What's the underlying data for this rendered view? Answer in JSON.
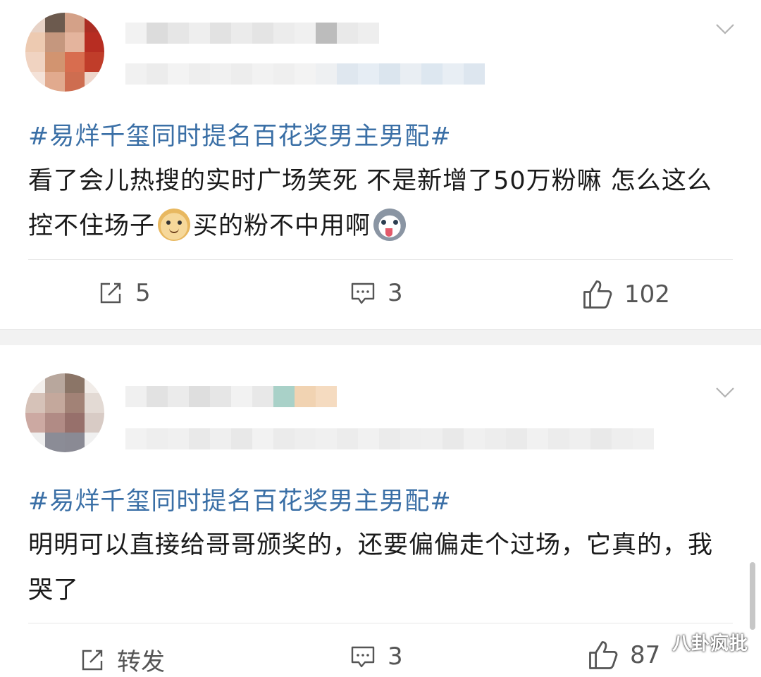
{
  "posts": [
    {
      "topic": "#易烊千玺同时提名百花奖男主男配#",
      "text_part1": "看了会儿热搜的实时广场笑死 不是新增了50万粉嘛 怎么这么控不住场子",
      "text_part2": "买的粉不中用啊",
      "actions": {
        "repost": "5",
        "comment": "3",
        "like": "102"
      }
    },
    {
      "topic": "#易烊千玺同时提名百花奖男主男配#",
      "text": "明明可以直接给哥哥颁奖的，还要偏偏走个过场，它真的，我哭了",
      "actions": {
        "repost": "转发",
        "comment": "3",
        "like": "87"
      }
    }
  ],
  "watermark": "八卦疯批",
  "colors": {
    "topic": "#3a6fa6",
    "divider": "#e6e6e6",
    "gap": "#f2f2f2"
  },
  "icons": [
    "chevron-down-icon",
    "repost-icon",
    "comment-icon",
    "like-icon",
    "doge-emoji-icon",
    "husky-emoji-icon"
  ]
}
